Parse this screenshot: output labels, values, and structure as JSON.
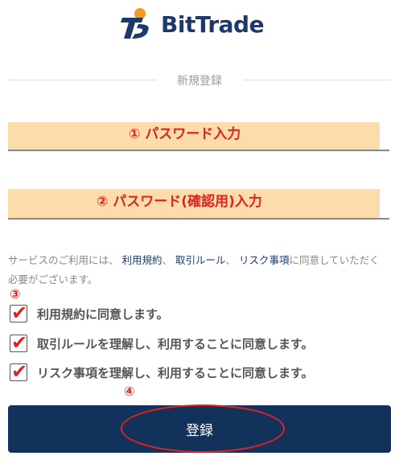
{
  "brand": {
    "name": "BitTrade",
    "logo_color": "#1b3a6b",
    "accent": "#f39a1e"
  },
  "section": {
    "title": "新規登録"
  },
  "password": {
    "value": "",
    "placeholder": "",
    "annotation": "① パスワード入力"
  },
  "password_confirm": {
    "value": "",
    "placeholder": "",
    "annotation": "② パスワード(確認用)入力"
  },
  "notice": {
    "prefix": "サービスのご利用には、",
    "link_terms": "利用規約",
    "sep1": "、",
    "link_rules": "取引ルール",
    "sep2": "、",
    "link_risk": "リスク事項",
    "suffix": "に同意していただく必要がございます。"
  },
  "annotations": {
    "step3": "③",
    "step4": "④"
  },
  "agreements": [
    {
      "label": "利用規約に同意します。",
      "checked": true
    },
    {
      "label": "取引ルールを理解し、利用することに同意します。",
      "checked": true
    },
    {
      "label": "リスク事項を理解し、利用することに同意します。",
      "checked": true
    }
  ],
  "submit": {
    "label": "登録"
  },
  "colors": {
    "button_bg": "#12325b",
    "annotation_red": "#e0231f",
    "highlight": "#fbdcaa"
  }
}
